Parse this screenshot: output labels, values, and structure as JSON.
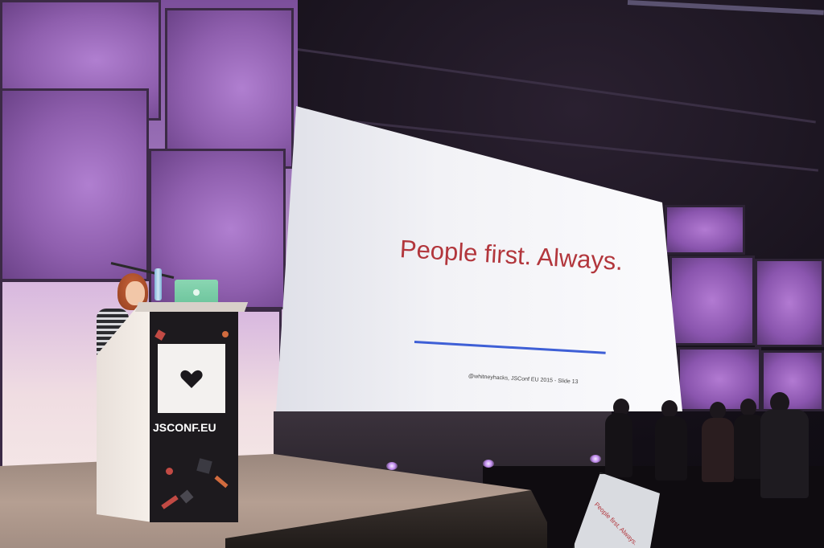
{
  "slide": {
    "title": "People first. Always.",
    "footer": "@whitneyhacks, JSConf EU 2015 - Slide 13",
    "title_color": "#b2363c",
    "rule_color": "#3e5fd6"
  },
  "podium": {
    "brand": "JSCONF.EU",
    "card_icon": "heart-icon"
  },
  "monitor": {
    "text": "People first. Always."
  },
  "colors": {
    "wall_purple": "#8f5fae",
    "stage": "#b59f92",
    "laptop": "#7dcda8"
  }
}
